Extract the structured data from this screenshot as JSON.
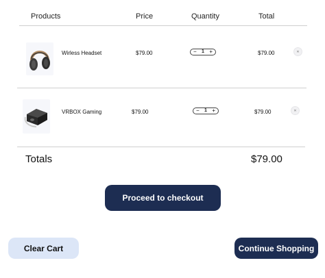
{
  "table": {
    "headers": {
      "products": "Products",
      "price": "Price",
      "quantity": "Quantity",
      "total": "Total"
    },
    "rows": [
      {
        "name": "Wirless Headset",
        "price": "$79.00",
        "quantity": "1",
        "total": "$79.00",
        "image_icon": "headset-icon"
      },
      {
        "name": "VRBOX Gaming",
        "price": "$79.00",
        "quantity": "1",
        "total": "$79.00",
        "image_icon": "vr-headset-icon"
      }
    ],
    "stepper": {
      "minus": "−",
      "plus": "+"
    },
    "remove_icon": "close-icon"
  },
  "totals": {
    "label": "Totals",
    "value": "$79.00"
  },
  "buttons": {
    "checkout": "Proceed to checkout",
    "clear": "Clear Cart",
    "continue": "Continue Shopping"
  },
  "colors": {
    "primary": "#1d2d52",
    "secondary": "#dce6f7",
    "divider": "#cfcfcf"
  }
}
